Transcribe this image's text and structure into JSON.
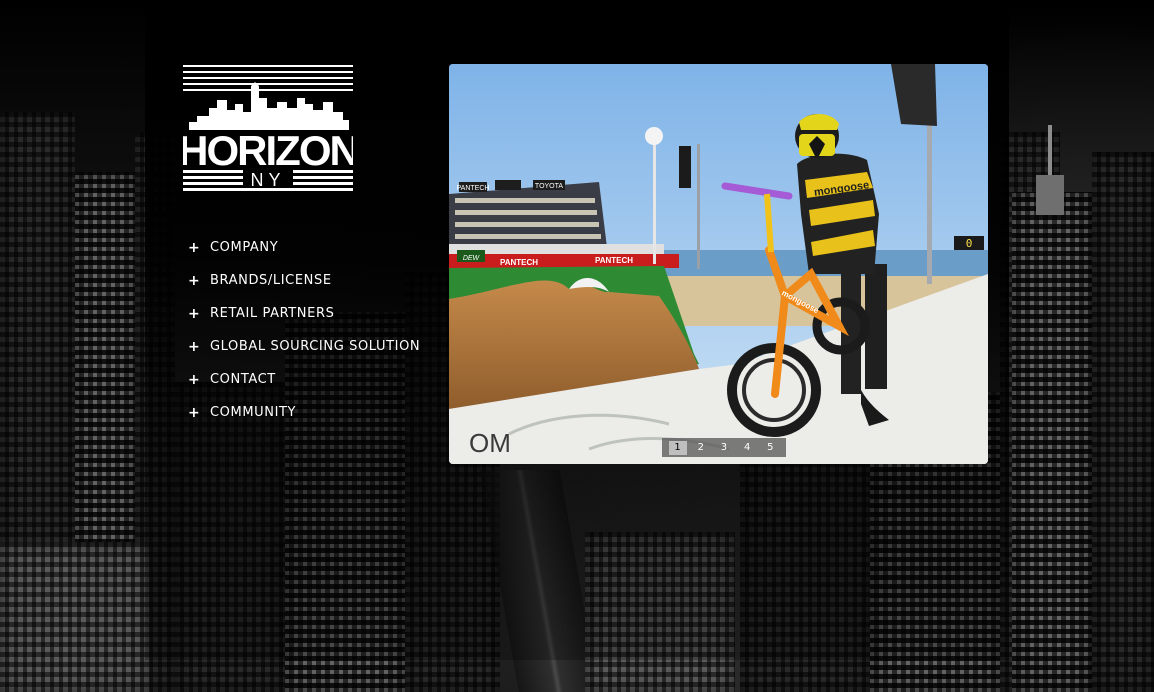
{
  "logo": {
    "main_text": "HORIZON",
    "sub_text": "NY"
  },
  "nav": {
    "items": [
      {
        "plus": "+",
        "label": "COMPANY"
      },
      {
        "plus": "+",
        "label": "BRANDS/LICENSE"
      },
      {
        "plus": "+",
        "label": "RETAIL PARTNERS"
      },
      {
        "plus": "+",
        "label": "GLOBAL SOURCING SOLUTION"
      },
      {
        "plus": "+",
        "label": "CONTACT"
      },
      {
        "plus": "+",
        "label": "COMMUNITY"
      }
    ]
  },
  "slideshow": {
    "signs": {
      "ramp_left": "PANTECH",
      "ramp_right": "PANTECH",
      "top_a": "PANTECH",
      "top_b": "TOYOTA",
      "dew": "DEW",
      "ramp_text": "OM",
      "tshirt": "mongoose",
      "bike": "mongoose",
      "scoreboard": "0"
    },
    "pager": {
      "pages": [
        "1",
        "2",
        "3",
        "4",
        "5"
      ],
      "active_index": 0
    }
  },
  "colors": {
    "accent_white": "#ffffff",
    "sky": "#9ac7ef",
    "ramp_green": "#2f8a34",
    "bike_orange": "#f08a1a",
    "tshirt_yellow": "#e8c21a"
  }
}
